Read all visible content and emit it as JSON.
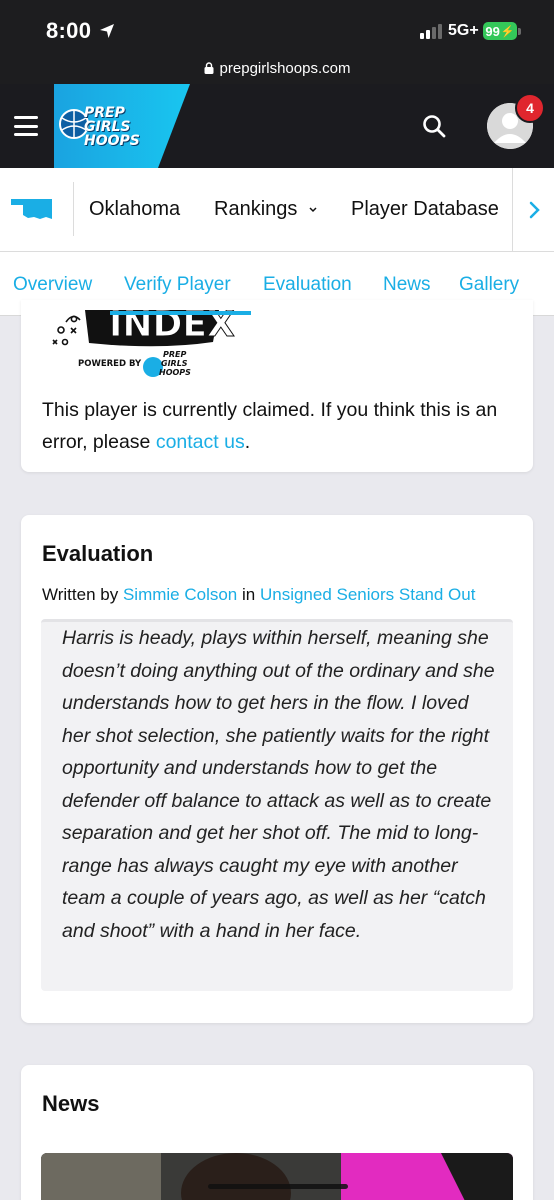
{
  "status_bar": {
    "time": "8:00",
    "network": "5G+",
    "battery": "99"
  },
  "browser": {
    "url": "prepgirlshoops.com"
  },
  "header": {
    "logo": {
      "line1": "PREP",
      "line2": "GIRLS",
      "line3": "HOOPS"
    },
    "notification_count": "4"
  },
  "state_nav": {
    "items": [
      "Oklahoma",
      "Rankings",
      "Player Database"
    ]
  },
  "tabs": {
    "items": [
      "Overview",
      "Verify Player",
      "Evaluation",
      "News",
      "Gallery"
    ],
    "active": "Verify Player"
  },
  "claim_card": {
    "index_word": "INDEX",
    "powered_by": "POWERED BY",
    "text": "This player is currently claimed. If you think this is an error, please ",
    "link": "contact us",
    "suffix": "."
  },
  "evaluation": {
    "title": "Evaluation",
    "written_by": "Written by",
    "author": "Simmie Colson",
    "in_text": "in",
    "article": "Unsigned Seniors Stand Out",
    "body": "Harris is heady, plays within herself, meaning she doesn’t doing anything out of the ordinary and she understands how to get hers in the flow. I loved her shot selection, she patiently waits for the right opportunity and understands how to get the defender off balance to attack as well as to create separation and get her shot off. The mid to long-range has always caught my eye with another team a couple of years ago, as well as her “catch and shoot” with a hand in her face."
  },
  "news": {
    "title": "News"
  },
  "colors": {
    "accent": "#1aaee5",
    "header_bg": "#1b1b1f",
    "badge": "#e0262e",
    "battery": "#34c759"
  }
}
